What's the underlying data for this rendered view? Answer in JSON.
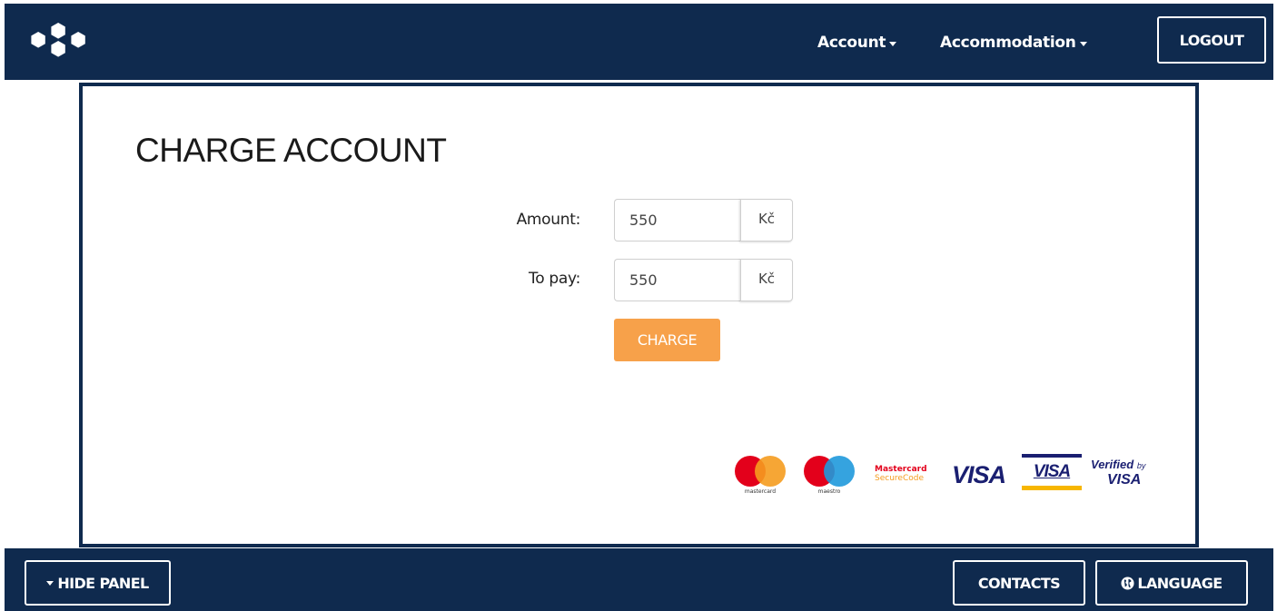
{
  "nav": {
    "account_label": "Account",
    "accommodation_label": "Accommodation",
    "logout_label": "LOGOUT"
  },
  "page": {
    "title": "CHARGE ACCOUNT"
  },
  "form": {
    "amount_label": "Amount:",
    "amount_value": "550",
    "amount_currency": "Kč",
    "topay_label": "To pay:",
    "topay_value": "550",
    "topay_currency": "Kč",
    "charge_label": "CHARGE"
  },
  "payment_logos": {
    "mastercard_caption": "mastercard",
    "maestro_caption": "maestro",
    "securecode_line1": "Mastercard",
    "securecode_line2": "SecureCode",
    "visa_text": "VISA",
    "visa_card_text": "VISA",
    "verified_line1": "Verified",
    "verified_by": "by",
    "verified_line2": "VISA"
  },
  "footer": {
    "hide_panel_label": "HIDE PANEL",
    "contacts_label": "CONTACTS",
    "language_label": "LANGUAGE"
  },
  "colors": {
    "navy": "#0f2a4e",
    "charge_orange": "#f7a14a",
    "mastercard_red": "#e3001b",
    "mastercard_orange": "#f59c1f",
    "maestro_blue": "#1f99dc",
    "visa_blue": "#1a1f71",
    "visa_gold": "#f7b600"
  },
  "icons": {
    "logo": "hexagon-cluster-logo",
    "dropdown": "caret-down-icon",
    "language": "globe-icon"
  }
}
